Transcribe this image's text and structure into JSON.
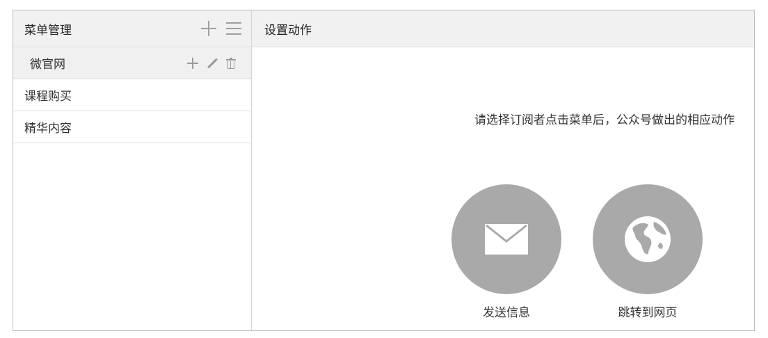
{
  "sidebar": {
    "title": "菜单管理",
    "items": [
      {
        "label": "微官网",
        "active": true
      },
      {
        "label": "课程购买",
        "active": false
      },
      {
        "label": "精华内容",
        "active": false
      }
    ]
  },
  "main": {
    "title": "设置动作",
    "prompt": "请选择订阅者点击菜单后，公众号做出的相应动作",
    "actions": [
      {
        "label": "发送信息",
        "icon": "envelope-icon"
      },
      {
        "label": "跳转到网页",
        "icon": "globe-icon"
      }
    ]
  },
  "colors": {
    "header_bg": "#f1f1f1",
    "circle": "#a9a9a9",
    "icon_gray": "#9e9e9e"
  }
}
